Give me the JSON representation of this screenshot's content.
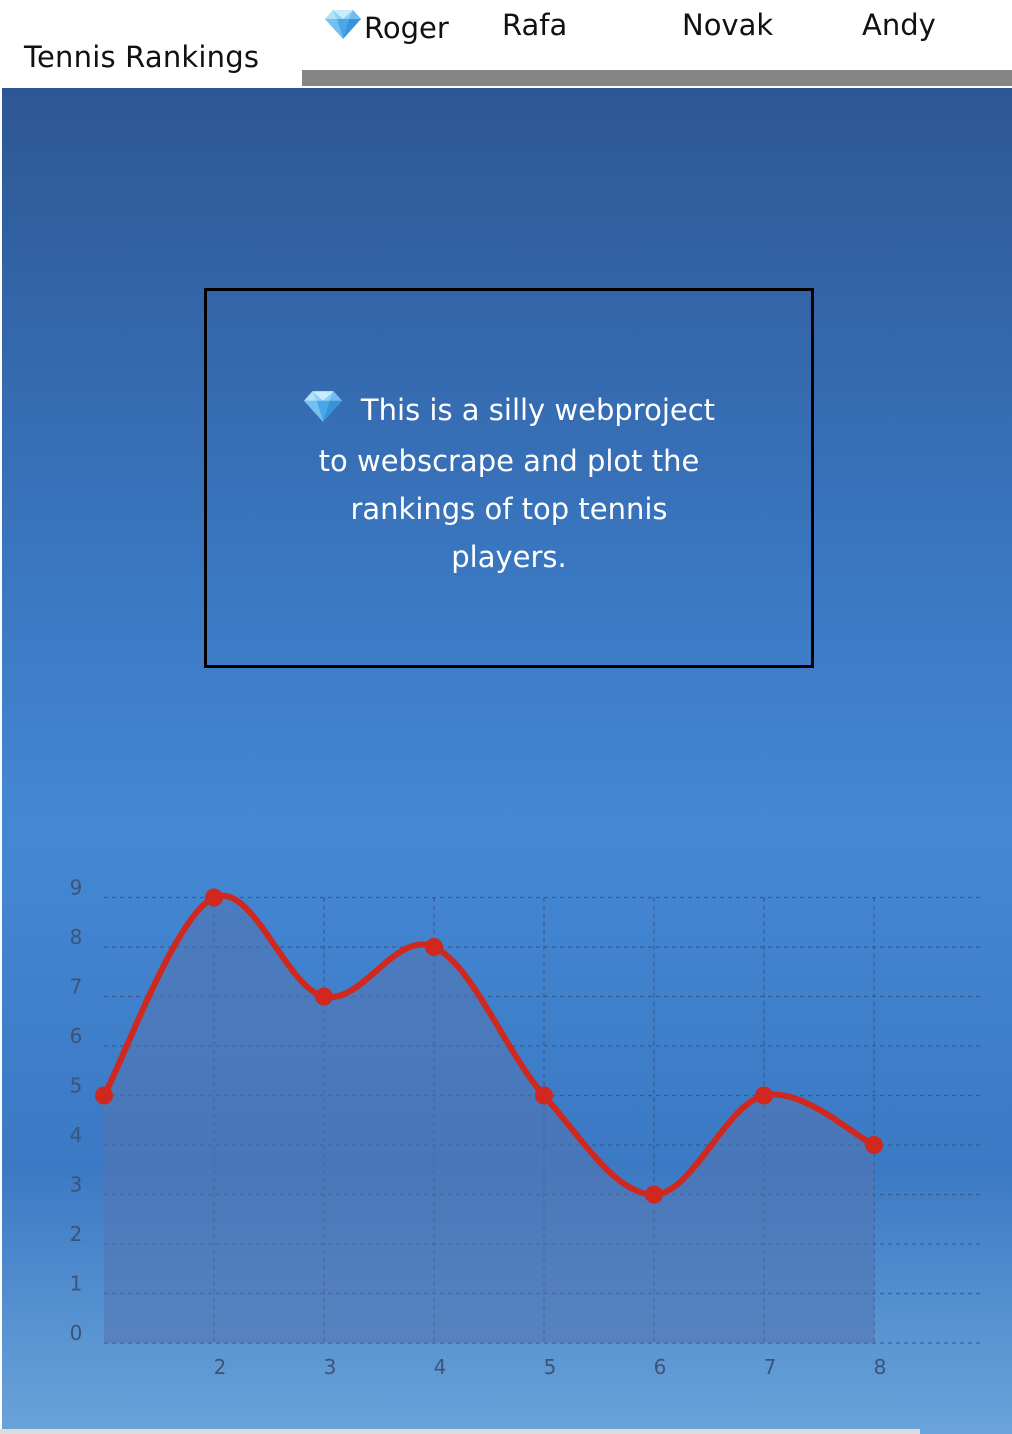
{
  "header": {
    "title": "Tennis Rankings",
    "nav": [
      {
        "label": "Roger",
        "icon": "gem-icon"
      },
      {
        "label": "Rafa"
      },
      {
        "label": "Novak"
      },
      {
        "label": "Andy"
      }
    ]
  },
  "info": {
    "icon": "gem-icon",
    "text": "This is a silly webproject to webscrape and plot the rankings of top tennis players."
  },
  "colors": {
    "line": "#d0281e",
    "point": "#d0281e",
    "area": "#5374b0",
    "grid": "#3a5078",
    "nav_bar": "#858585"
  },
  "chart_data": {
    "type": "area",
    "x": [
      1,
      2,
      3,
      4,
      5,
      6,
      7,
      8
    ],
    "values": [
      5,
      9,
      7,
      8,
      5,
      3,
      5,
      4
    ],
    "x_tick_labels": [
      "2",
      "3",
      "4",
      "5",
      "6",
      "7",
      "8"
    ],
    "y_tick_labels": [
      "0",
      "1",
      "2",
      "3",
      "4",
      "5",
      "6",
      "7",
      "8",
      "9"
    ],
    "ylim": [
      0,
      9
    ],
    "xlim": [
      1,
      9
    ],
    "grid": true,
    "smooth": true,
    "legend": false
  }
}
